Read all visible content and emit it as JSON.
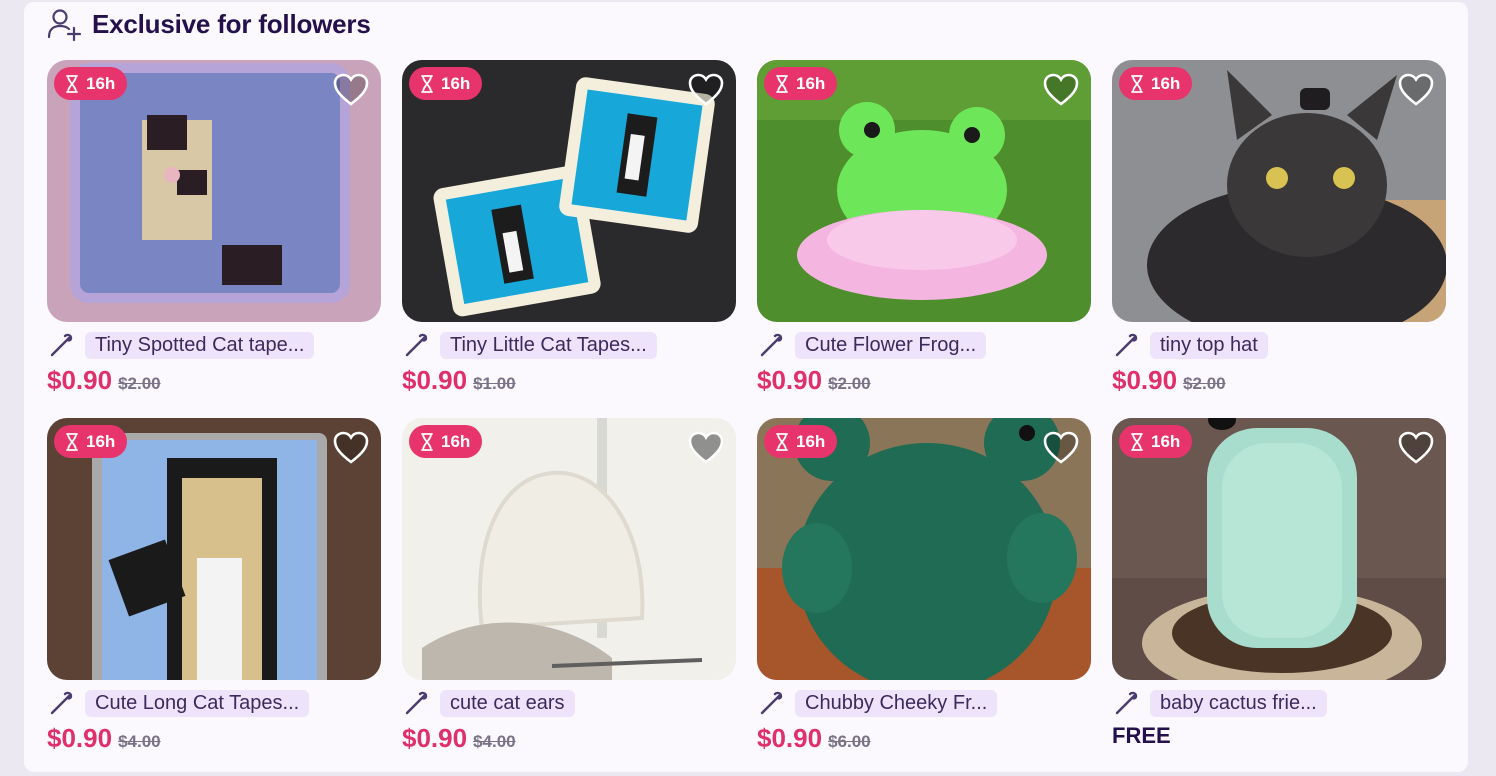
{
  "section": {
    "title": "Exclusive for followers",
    "icon": "user-plus-icon"
  },
  "colors": {
    "accent": "#e8346c",
    "price": "#e0306a",
    "chip_bg": "#ede4fb",
    "title": "#24104a"
  },
  "products": [
    {
      "timer": "16h",
      "name": "Tiny Spotted Cat tape...",
      "price": "$0.90",
      "old_price": "$2.00"
    },
    {
      "timer": "16h",
      "name": "Tiny Little Cat Tapes...",
      "price": "$0.90",
      "old_price": "$1.00"
    },
    {
      "timer": "16h",
      "name": "Cute Flower Frog...",
      "price": "$0.90",
      "old_price": "$2.00"
    },
    {
      "timer": "16h",
      "name": "tiny top hat",
      "price": "$0.90",
      "old_price": "$2.00"
    },
    {
      "timer": "16h",
      "name": "Cute Long Cat Tapes...",
      "price": "$0.90",
      "old_price": "$4.00"
    },
    {
      "timer": "16h",
      "name": "cute cat ears",
      "price": "$0.90",
      "old_price": "$4.00"
    },
    {
      "timer": "16h",
      "name": "Chubby Cheeky Fr...",
      "price": "$0.90",
      "old_price": "$6.00"
    },
    {
      "timer": "16h",
      "name": "baby cactus frie...",
      "free_label": "FREE"
    }
  ]
}
